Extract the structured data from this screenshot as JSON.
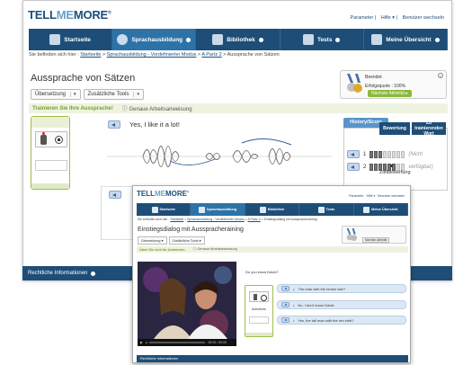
{
  "app": {
    "logo_a": "TELL",
    "logo_b": "ME",
    "logo_c": "MORE",
    "logo_r": "®"
  },
  "top_links": [
    "Parameter",
    "Hilfe ▾",
    "Benutzer wechseln"
  ],
  "nav": [
    {
      "label": "Startseite",
      "icon": "home-icon"
    },
    {
      "label": "Sprachausbildung",
      "icon": "student-icon",
      "active": true
    },
    {
      "label": "Bibliothek",
      "icon": "book-icon"
    },
    {
      "label": "Tests",
      "icon": "graduation-cap-icon"
    },
    {
      "label": "Meine Übersicht",
      "icon": "profile-card-icon"
    }
  ],
  "breadcrumb": {
    "prefix": "Sie befinden sich hier :",
    "items": [
      "Startseite",
      "Sprachausbildung - Vordefinierter Modus",
      "A Partz 2"
    ],
    "current": "Aussprache von Sätzen"
  },
  "page_title": "Aussprache von Sätzen",
  "dropdowns": [
    "Übersetzung",
    "Zusätzliche Tools"
  ],
  "score_box": {
    "line1": "Beendet",
    "line2": "Erfolgsquote : 100%",
    "next_button": "Nächste Aktivität"
  },
  "instruction_band": {
    "main": "Trainieren Sie Ihre Aussprache!",
    "hint": "ⓘ Genaue Arbeitsanweisung"
  },
  "sentence": "Yes, I like it a lot!",
  "history": {
    "tab": "History/Score",
    "col_rating": "Bewertung",
    "col_words": "Zu trainierenden Wort",
    "rows": [
      {
        "num": "1",
        "filled": 3,
        "total": 8,
        "word": "(Nicht"
      },
      {
        "num": "2",
        "filled": 6,
        "total": 8,
        "word": "verfügbar)"
      }
    ],
    "target_label": "Zielbewertung"
  },
  "footer": "Rechtliche Informationen",
  "inset": {
    "top_links": "Parameter · Hilfe ▾ · Benutzer wechseln",
    "nav": [
      {
        "label": "Startseite"
      },
      {
        "label": "Sprachausbildung",
        "active": true
      },
      {
        "label": "Bibliothek"
      },
      {
        "label": "Tests"
      },
      {
        "label": "Meine Übersicht"
      }
    ],
    "breadcrumb_prefix": "Sie befinden sich hier :",
    "breadcrumb_items": [
      "Startseite",
      "Sprachausbildung - Vordefinierter Modus",
      "A Partz 2"
    ],
    "breadcrumb_current": "Einstiegsdialog mit Ausspracheraining",
    "title": "Einstiegsdialog mit Ausspracheraining",
    "dropdowns": [
      "Übersetzung",
      "Zusätzliche Tools"
    ],
    "next_button": "Nächste Aktivität",
    "band_main": "Üben Sie sich Ihr Antworten.",
    "band_hint": "ⓘ Genaue Arbeitsanweisung",
    "question": "Do you know David?",
    "rec_label": "Aufnahme",
    "video_time": "00:00 / 00:00",
    "answers": [
      "The man with the brown hair?",
      "No, I don't know David.",
      "Yes, the tall man with the red shirt?"
    ],
    "footer": "Rechtliche Informationen"
  }
}
